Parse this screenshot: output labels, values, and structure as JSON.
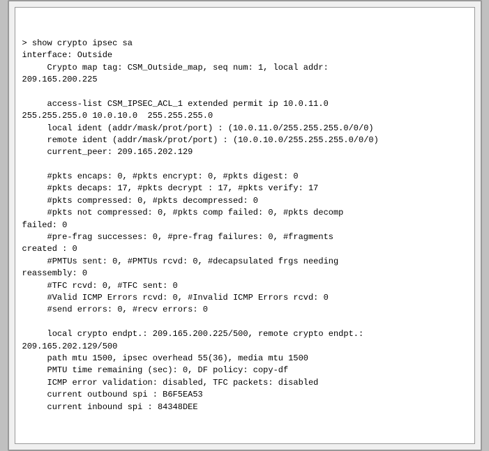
{
  "terminal": {
    "content": "> show crypto ipsec sa\ninterface: Outside\n     Crypto map tag: CSM_Outside_map, seq num: 1, local addr:\n209.165.200.225\n\n     access-list CSM_IPSEC_ACL_1 extended permit ip 10.0.11.0\n255.255.255.0 10.0.10.0  255.255.255.0\n     local ident (addr/mask/prot/port) : (10.0.11.0/255.255.255.0/0/0)\n     remote ident (addr/mask/prot/port) : (10.0.10.0/255.255.255.0/0/0)\n     current_peer: 209.165.202.129\n\n     #pkts encaps: 0, #pkts encrypt: 0, #pkts digest: 0\n     #pkts decaps: 17, #pkts decrypt : 17, #pkts verify: 17\n     #pkts compressed: 0, #pkts decompressed: 0\n     #pkts not compressed: 0, #pkts comp failed: 0, #pkts decomp\nfailed: 0\n     #pre-frag successes: 0, #pre-frag failures: 0, #fragments\ncreated : 0\n     #PMTUs sent: 0, #PMTUs rcvd: 0, #decapsulated frgs needing\nreassembly: 0\n     #TFC rcvd: 0, #TFC sent: 0\n     #Valid ICMP Errors rcvd: 0, #Invalid ICMP Errors rcvd: 0\n     #send errors: 0, #recv errors: 0\n\n     local crypto endpt.: 209.165.200.225/500, remote crypto endpt.:\n209.165.202.129/500\n     path mtu 1500, ipsec overhead 55(36), media mtu 1500\n     PMTU time remaining (sec): 0, DF policy: copy-df\n     ICMP error validation: disabled, TFC packets: disabled\n     current outbound spi : B6F5EA53\n     current inbound spi : 84348DEE"
  }
}
